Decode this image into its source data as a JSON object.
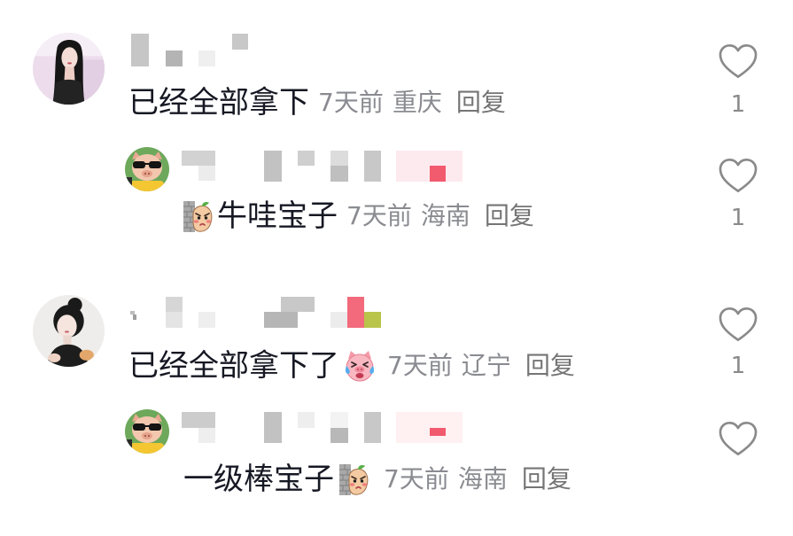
{
  "theme": {
    "background": "#ffffff",
    "text_primary": "#161823",
    "text_secondary": "#8a8b91",
    "reply_link": "#757575",
    "icon_stroke": "#8a8a8a"
  },
  "comments": [
    {
      "text": "已经全部拿下",
      "time": "7天前",
      "location": "重庆",
      "reply_label": "回复",
      "like_icon": "heart-outline-icon",
      "like_count": "1",
      "replies": [
        {
          "emoji_before_text": "peanut-wall-sticker-icon",
          "text": "牛哇宝子",
          "time": "7天前",
          "location": "海南",
          "reply_label": "回复",
          "like_icon": "heart-outline-icon",
          "like_count": "1"
        }
      ]
    },
    {
      "text": "已经全部拿下了",
      "emoji_after_text": "crying-pig-sticker-icon",
      "time": "7天前",
      "location": "辽宁",
      "reply_label": "回复",
      "like_icon": "heart-outline-icon",
      "like_count": "1",
      "replies": [
        {
          "text": "一级棒宝子",
          "emoji_after_text": "peanut-wall-sticker-icon",
          "time": "7天前",
          "location": "海南",
          "reply_label": "回复",
          "like_icon": "heart-outline-icon"
        }
      ]
    }
  ]
}
